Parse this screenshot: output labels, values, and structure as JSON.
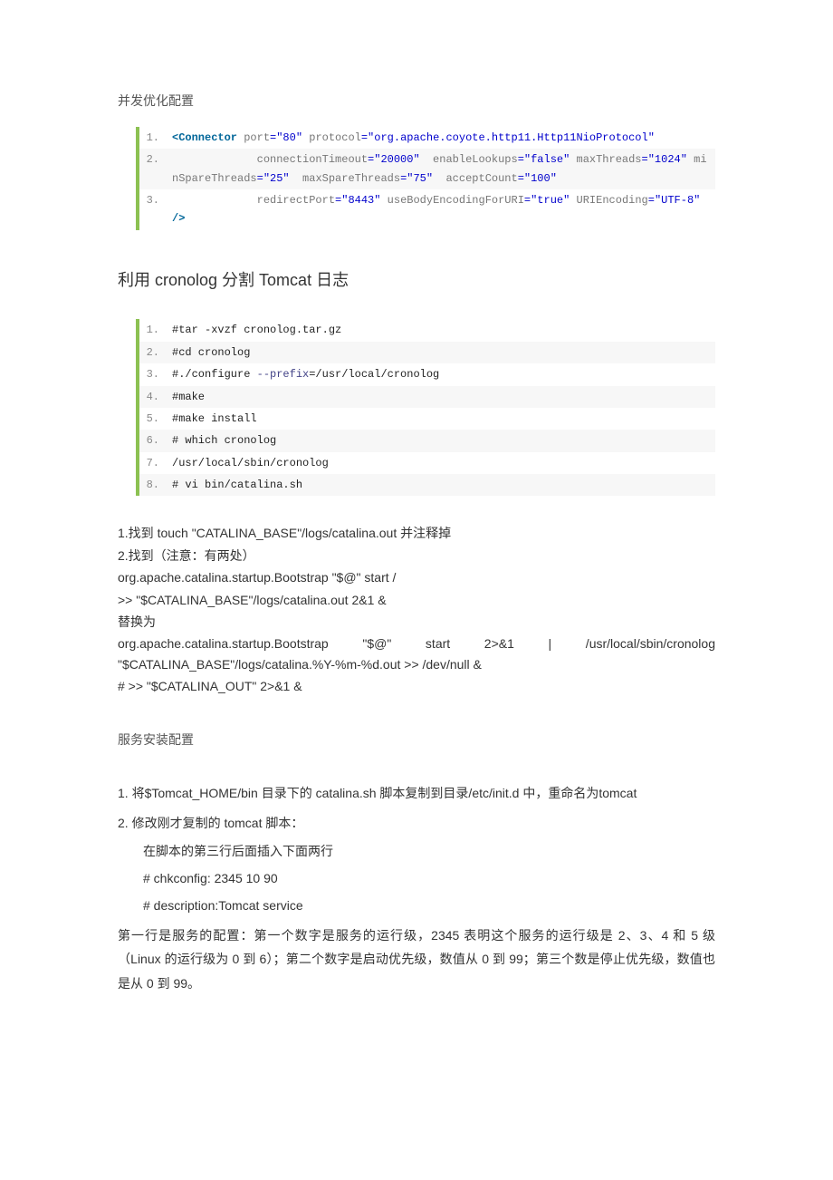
{
  "titles": {
    "sec1": "并发优化配置",
    "sec2": "利用 cronolog  分割 Tomcat 日志",
    "sec3": "服务安装配置"
  },
  "code1": {
    "l1_tag": "<Connector",
    "l1_a1": " port",
    "l1_v1": "=\"80\"",
    "l1_a2": " protocol",
    "l1_v2": "=\"org.apache.coyote.http11.Http11NioProtocol\"",
    "l2_pad": "             ",
    "l2_a1": "connectionTimeout",
    "l2_v1": "=\"20000\" ",
    "l2_a2": " enableLookups",
    "l2_v2": "=\"false\"",
    "l2_a3": " maxThreads",
    "l2_v3": "=\"1024\"",
    "l2_a4": " minSpareThreads",
    "l2_v4": "=\"25\" ",
    "l2_a5": " maxSpareThreads",
    "l2_v5": "=\"75\" ",
    "l2_a6": " acceptCount",
    "l2_v6": "=\"100\"",
    "l3_pad": "             ",
    "l3_a1": "redirectPort",
    "l3_v1": "=\"8443\"",
    "l3_a2": " useBodyEncodingForURI",
    "l3_v2": "=\"true\"",
    "l3_a3": " URIEncoding",
    "l3_v3": "=\"UTF-8\"  ",
    "l3_end": "/>"
  },
  "code2": {
    "l1": "#tar -xvzf cronolog.tar.gz",
    "l2": "#cd cronolog",
    "l3a": "#./configure ",
    "l3b": "--prefix",
    "l3c": "=/usr/local/cronolog",
    "l4": "#make",
    "l5": "#make install",
    "l6": "# which cronolog",
    "l7": "/usr/local/sbin/cronolog",
    "l8": "# vi bin/catalina.sh"
  },
  "body": {
    "p1": "1.找到  touch \"CATALINA_BASE\"/logs/catalina.out  并注释掉",
    "p2": "2.找到（注意：有两处）",
    "p3": "org.apache.catalina.startup.Bootstrap \"$@\" start /",
    "p4": ">> \"$CATALINA_BASE\"/logs/catalina.out 2&1 &",
    "p5": "替换为",
    "p6": "org.apache.catalina.startup.Bootstrap   \"$@\"   start   2>&1   |   /usr/local/sbin/cronolog \"$CATALINA_BASE\"/logs/catalina.%Y-%m-%d.out >> /dev/null &",
    "p7": "# >> \"$CATALINA_OUT\" 2>&1 &"
  },
  "svc": {
    "p1": "1.  将$Tomcat_HOME/bin 目录下的 catalina.sh 脚本复制到目录/etc/init.d 中，重命名为tomcat",
    "p2": "2.  修改刚才复制的 tomcat 脚本：",
    "p3": "在脚本的第三行后面插入下面两行",
    "p4": "# chkconfig: 2345 10 90",
    "p5": "# description:Tomcat service",
    "p6": "      第一行是服务的配置：第一个数字是服务的运行级，2345 表明这个服务的运行级是 2、3、4 和 5 级（Linux 的运行级为 0 到 6）；第二个数字是启动优先级，数值从 0 到 99；第三个数是停止优先级，数值也是从 0 到 99。"
  }
}
